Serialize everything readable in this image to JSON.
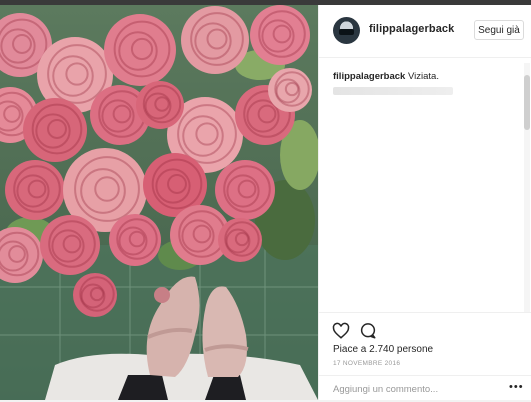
{
  "post": {
    "username": "filippalagerback",
    "follow_label": "Segui già",
    "caption_user": "filippalagerback",
    "caption_text": "Viziata.",
    "likes": "Piace a 2.740 persone",
    "date": "17 NOVEMBRE 2016",
    "comment_placeholder": "Aggiungi un commento...",
    "more_label": "•••"
  },
  "icons": [
    "heart-icon",
    "comment-icon",
    "more-options-icon"
  ],
  "colors": {
    "text": "#262626",
    "muted": "#999999",
    "border": "#efefef"
  }
}
